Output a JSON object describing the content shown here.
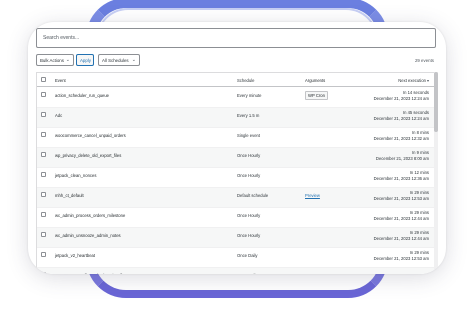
{
  "search": {
    "placeholder": "Search events..."
  },
  "toolbar": {
    "bulk_actions": "Bulk Actions",
    "apply": "Apply",
    "schedules_filter": "All Schedules",
    "event_count": "29 events"
  },
  "table": {
    "headers": {
      "event": "Event",
      "schedule": "Schedule",
      "arguments": "Arguments",
      "next_execution": "Next execution"
    },
    "rows": [
      {
        "event": "action_scheduler_run_queue",
        "schedule": "Every minute",
        "arguments": "WP Cron",
        "arg_type": "chip",
        "next_rel": "In 14 seconds",
        "next_abs": "December 21, 2023 12:24 am"
      },
      {
        "event": "Adc",
        "schedule": "Every 1.5 m",
        "arguments": "",
        "arg_type": "none",
        "next_rel": "In 45 seconds",
        "next_abs": "December 21, 2023 12:24 am"
      },
      {
        "event": "woocommerce_cancel_unpaid_orders",
        "schedule": "Single event",
        "arguments": "",
        "arg_type": "none",
        "next_rel": "In 8 mins",
        "next_abs": "December 21, 2023 12:32 am"
      },
      {
        "event": "wp_privacy_delete_old_export_files",
        "schedule": "Once Hourly",
        "arguments": "",
        "arg_type": "none",
        "next_rel": "In 9 mins",
        "next_abs": "December 21, 2023 8:00 am"
      },
      {
        "event": "jetpack_clean_nonces",
        "schedule": "Once Hourly",
        "arguments": "",
        "arg_type": "none",
        "next_rel": "In 12 mins",
        "next_abs": "December 21, 2023 12:36 am"
      },
      {
        "event": "mhh_ct_default",
        "schedule": "Default schedule",
        "arguments": "Preview",
        "arg_type": "link",
        "next_rel": "In 29 mins",
        "next_abs": "December 21, 2023 12:53 am"
      },
      {
        "event": "wc_admin_process_orders_milestone",
        "schedule": "Once Hourly",
        "arguments": "",
        "arg_type": "none",
        "next_rel": "In 29 mins",
        "next_abs": "December 21, 2023 12:44 am"
      },
      {
        "event": "wc_admin_unsnooze_admin_notes",
        "schedule": "Once Hourly",
        "arguments": "",
        "arg_type": "none",
        "next_rel": "In 29 mins",
        "next_abs": "December 21, 2023 12:44 am"
      },
      {
        "event": "jetpack_v2_heartbeat",
        "schedule": "Once Daily",
        "arguments": "",
        "arg_type": "none",
        "next_rel": "In 29 mins",
        "next_abs": "December 21, 2023 12:53 am"
      },
      {
        "event": "woocommerce_fbm_tab_domain_cfb",
        "schedule": "Once Daily",
        "arguments": "",
        "arg_type": "none",
        "next_rel": "",
        "next_abs": ""
      }
    ]
  },
  "colors": {
    "accent": "#2271b1",
    "frame_gradient": "#6b7fe0"
  }
}
